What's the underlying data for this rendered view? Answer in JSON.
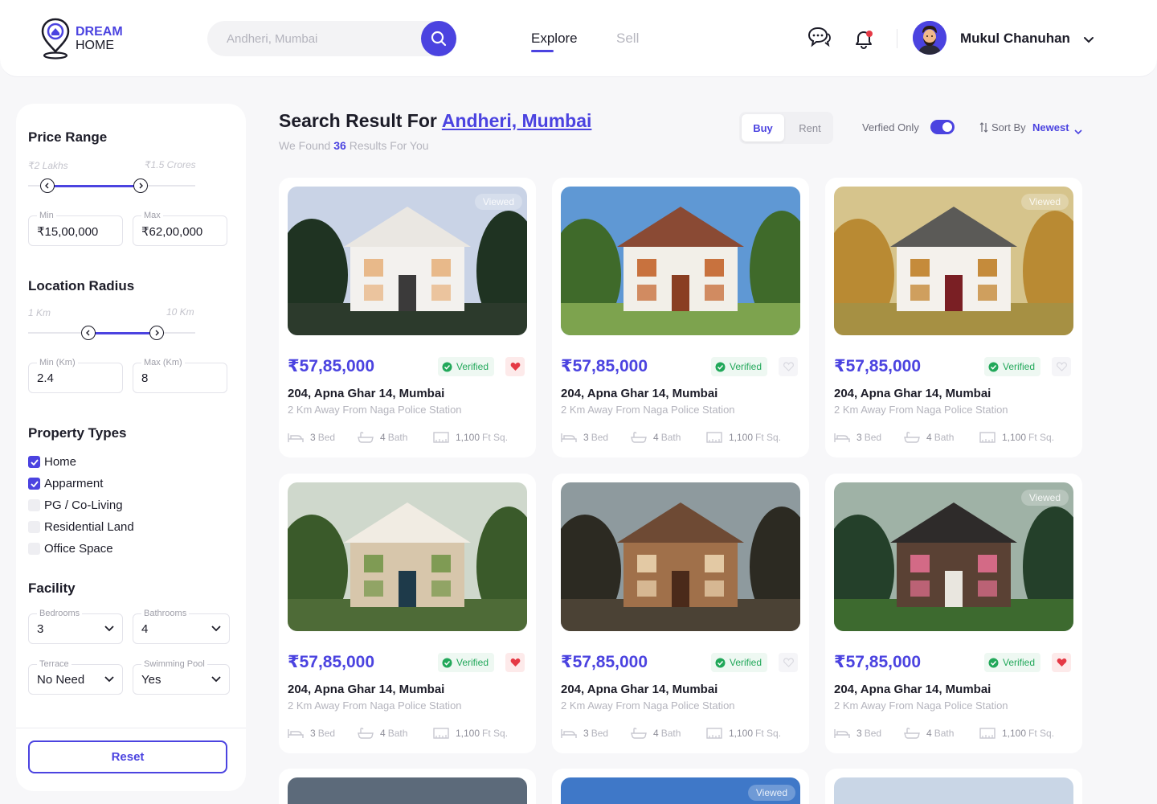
{
  "brand": {
    "line1": "DREAM",
    "line2": "HOME"
  },
  "search": {
    "placeholder": "Andheri, Mumbai"
  },
  "nav": {
    "explore": "Explore",
    "sell": "Sell"
  },
  "user": {
    "name": "Mukul Chanuhan"
  },
  "filters": {
    "price_range": {
      "title": "Price Range",
      "min_hint": "₹2 Lakhs",
      "max_hint": "₹1.5 Crores",
      "min_label": "Min",
      "max_label": "Max",
      "min_value": "₹15,00,000",
      "max_value": "₹62,00,000"
    },
    "location_radius": {
      "title": "Location Radius",
      "min_hint": "1 Km",
      "max_hint": "10 Km",
      "min_label": "Min (Km)",
      "max_label": "Max (Km)",
      "min_value": "2.4",
      "max_value": "8"
    },
    "property_types": {
      "title": "Property Types",
      "items": [
        {
          "label": "Home",
          "checked": true
        },
        {
          "label": "Apparment",
          "checked": true
        },
        {
          "label": "PG / Co-Living",
          "checked": false
        },
        {
          "label": "Residential Land",
          "checked": false
        },
        {
          "label": "Office Space",
          "checked": false
        }
      ]
    },
    "facility": {
      "title": "Facility",
      "bedrooms_label": "Bedrooms",
      "bedrooms_value": "3",
      "bathrooms_label": "Bathrooms",
      "bathrooms_value": "4",
      "terrace_label": "Terrace",
      "terrace_value": "No Need",
      "pool_label": "Swimming Pool",
      "pool_value": "Yes"
    },
    "reset_label": "Reset"
  },
  "results": {
    "title_prefix": "Search Result For",
    "location": "Andheri, Mumbai",
    "sub_prefix": "We Found",
    "count": "36",
    "sub_suffix": "Results For You"
  },
  "toolbar": {
    "buy": "Buy",
    "rent": "Rent",
    "verified_only": "Verfied Only",
    "sort_by": "Sort By",
    "sort_value": "Newest"
  },
  "listings": [
    {
      "viewed_label": "Viewed",
      "price": "₹57,85,000",
      "verified": "Verified",
      "favorite": true,
      "address": "204, Apna Ghar 14, Mumbai",
      "distance": "2 Km Away From Naga Police Station",
      "bed": "3",
      "bed_unit": "Bed",
      "bath": "4",
      "bath_unit": "Bath",
      "area": "1,100",
      "area_unit": "Ft Sq."
    },
    {
      "viewed_label": "",
      "price": "₹57,85,000",
      "verified": "Verified",
      "favorite": false,
      "address": "204, Apna Ghar 14, Mumbai",
      "distance": "2 Km Away From Naga Police Station",
      "bed": "3",
      "bed_unit": "Bed",
      "bath": "4",
      "bath_unit": "Bath",
      "area": "1,100",
      "area_unit": "Ft Sq."
    },
    {
      "viewed_label": "Viewed",
      "price": "₹57,85,000",
      "verified": "Verified",
      "favorite": false,
      "address": "204, Apna Ghar 14, Mumbai",
      "distance": "2 Km Away From Naga Police Station",
      "bed": "3",
      "bed_unit": "Bed",
      "bath": "4",
      "bath_unit": "Bath",
      "area": "1,100",
      "area_unit": "Ft Sq."
    },
    {
      "viewed_label": "",
      "price": "₹57,85,000",
      "verified": "Verified",
      "favorite": true,
      "address": "204, Apna Ghar 14, Mumbai",
      "distance": "2 Km Away From Naga Police Station",
      "bed": "3",
      "bed_unit": "Bed",
      "bath": "4",
      "bath_unit": "Bath",
      "area": "1,100",
      "area_unit": "Ft Sq."
    },
    {
      "viewed_label": "",
      "price": "₹57,85,000",
      "verified": "Verified",
      "favorite": false,
      "address": "204, Apna Ghar 14, Mumbai",
      "distance": "2 Km Away From Naga Police Station",
      "bed": "3",
      "bed_unit": "Bed",
      "bath": "4",
      "bath_unit": "Bath",
      "area": "1,100",
      "area_unit": "Ft Sq."
    },
    {
      "viewed_label": "Viewed",
      "price": "₹57,85,000",
      "verified": "Verified",
      "favorite": true,
      "address": "204, Apna Ghar 14, Mumbai",
      "distance": "2 Km Away From Naga Police Station",
      "bed": "3",
      "bed_unit": "Bed",
      "bath": "4",
      "bath_unit": "Bath",
      "area": "1,100",
      "area_unit": "Ft Sq."
    }
  ],
  "peek_listings": [
    {
      "viewed_label": ""
    },
    {
      "viewed_label": "Viewed"
    },
    {
      "viewed_label": ""
    }
  ],
  "colors": {
    "accent": "#4b43e0",
    "verified": "#22a85a",
    "favorite": "#e53945"
  },
  "icons": [
    "location-pin-logo-icon",
    "search-icon",
    "chat-icon",
    "bell-icon",
    "chevron-down-icon",
    "sort-icon",
    "check-icon",
    "shield-check-icon",
    "heart-icon",
    "bed-icon",
    "bath-icon",
    "area-icon"
  ]
}
